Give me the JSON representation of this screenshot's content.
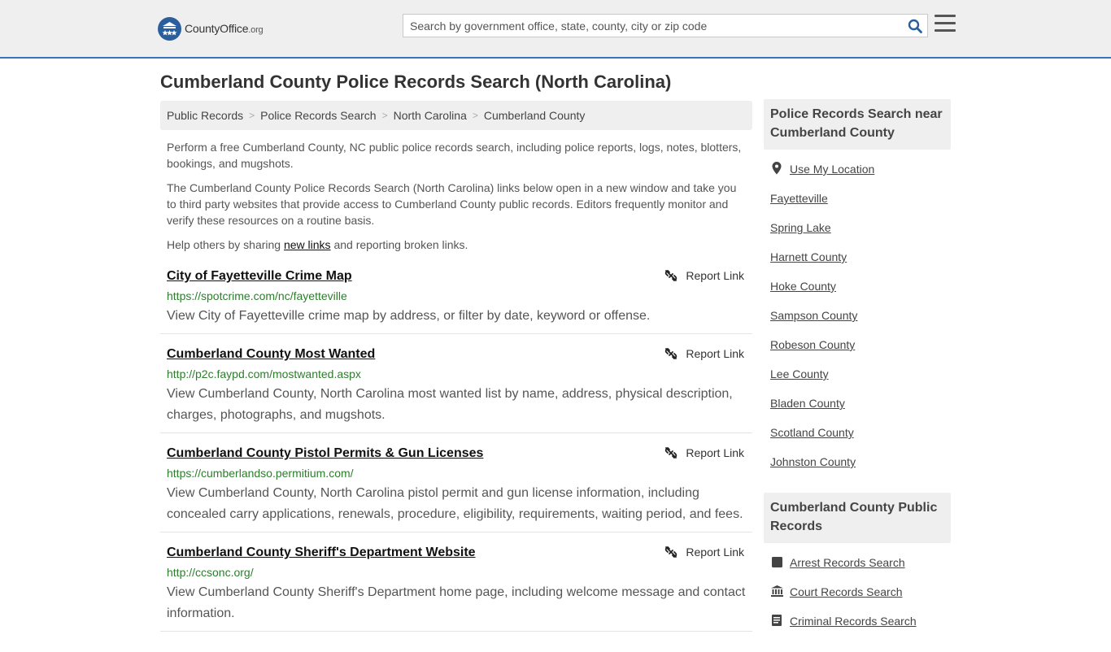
{
  "header": {
    "logo_county": "County",
    "logo_office": "Office",
    "logo_org": ".org",
    "search_placeholder": "Search by government office, state, county, city or zip code"
  },
  "page_title": "Cumberland County Police Records Search (North Carolina)",
  "breadcrumb": [
    "Public Records",
    "Police Records Search",
    "North Carolina",
    "Cumberland County"
  ],
  "intro": {
    "p1": "Perform a free Cumberland County, NC public police records search, including police reports, logs, notes, blotters, bookings, and mugshots.",
    "p2": "The Cumberland County Police Records Search (North Carolina) links below open in a new window and take you to third party websites that provide access to Cumberland County public records. Editors frequently monitor and verify these resources on a routine basis.",
    "p3_pre": "Help others by sharing ",
    "p3_link": "new links",
    "p3_post": " and reporting broken links."
  },
  "report_label": "Report Link",
  "results": [
    {
      "title": "City of Fayetteville Crime Map",
      "url": "https://spotcrime.com/nc/fayetteville",
      "desc": "View City of Fayetteville crime map by address, or filter by date, keyword or offense."
    },
    {
      "title": "Cumberland County Most Wanted",
      "url": "http://p2c.faypd.com/mostwanted.aspx",
      "desc": "View Cumberland County, North Carolina most wanted list by name, address, physical description, charges, photographs, and mugshots."
    },
    {
      "title": "Cumberland County Pistol Permits & Gun Licenses",
      "url": "https://cumberlandso.permitium.com/",
      "desc": "View Cumberland County, North Carolina pistol permit and gun license information, including concealed carry applications, renewals, procedure, eligibility, requirements, waiting period, and fees."
    },
    {
      "title": "Cumberland County Sheriff's Department Website",
      "url": "http://ccsonc.org/",
      "desc": "View Cumberland County Sheriff's Department home page, including welcome message and contact information."
    }
  ],
  "sidebar": {
    "near_title": "Police Records Search near Cumberland County",
    "use_location": "Use My Location",
    "near_items": [
      "Fayetteville",
      "Spring Lake",
      "Harnett County",
      "Hoke County",
      "Sampson County",
      "Robeson County",
      "Lee County",
      "Bladen County",
      "Scotland County",
      "Johnston County"
    ],
    "public_title": "Cumberland County Public Records",
    "public_items": [
      {
        "label": "Arrest Records Search",
        "icon": "square-icon"
      },
      {
        "label": "Court Records Search",
        "icon": "courthouse-icon"
      },
      {
        "label": "Criminal Records Search",
        "icon": "document-icon"
      }
    ]
  },
  "colors": {
    "accent": "#3a74bd",
    "url_green": "#2d7d2d",
    "header_bg": "#efefef"
  }
}
